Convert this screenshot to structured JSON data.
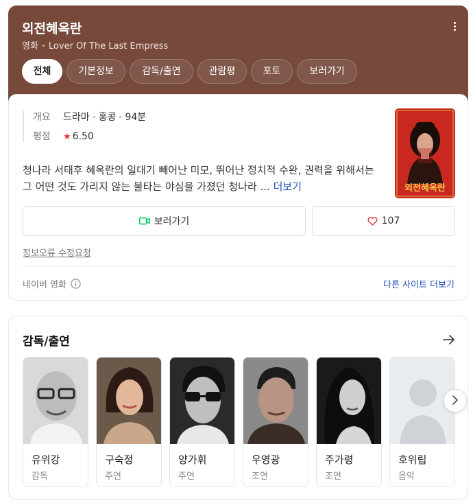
{
  "header": {
    "title": "외전혜옥란",
    "type": "영화",
    "english_title": "Lover Of The Last Empress",
    "menu_icon": "kebab-menu-icon",
    "bg_color": "#76493b"
  },
  "tabs": [
    {
      "label": "전체",
      "active": true
    },
    {
      "label": "기본정보",
      "active": false
    },
    {
      "label": "감독/출연",
      "active": false
    },
    {
      "label": "관람평",
      "active": false
    },
    {
      "label": "포토",
      "active": false
    },
    {
      "label": "보러가기",
      "active": false
    }
  ],
  "summary": {
    "overview_label": "개요",
    "genre": "드라마",
    "country": "홍콩",
    "runtime": "94분",
    "rating_label": "평점",
    "rating_value": "6.50",
    "synopsis": "청나라 서태후 혜옥란의 일대기 빼어난 미모, 뛰어난 정치적 수완, 권력을 위해서는 그 어떤 것도 가리지 않는 불타는 야심을 가졌던 청나라 ...",
    "more_label": "더보기",
    "poster_title": "외전혜옥란"
  },
  "actions": {
    "watch_label": "보러가기",
    "like_count": "107"
  },
  "footer": {
    "report_label": "정보오류 수정요청",
    "source_label": "네이버 영화",
    "other_sites_label": "다른 사이트 더보기"
  },
  "cast": {
    "title": "감독/출연",
    "people": [
      {
        "name": "유위강",
        "role": "감독"
      },
      {
        "name": "구숙정",
        "role": "주연"
      },
      {
        "name": "양가휘",
        "role": "주연"
      },
      {
        "name": "우영광",
        "role": "조연"
      },
      {
        "name": "주가령",
        "role": "조연"
      },
      {
        "name": "호위립",
        "role": "음악"
      }
    ]
  },
  "colors": {
    "accent_link": "#1e4db7",
    "star": "#e73540",
    "watch_icon": "#03c75a"
  }
}
